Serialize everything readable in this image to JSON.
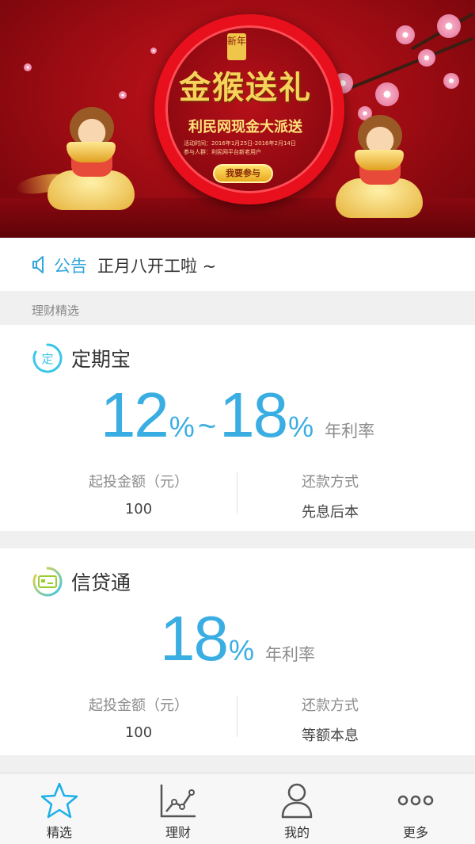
{
  "banner": {
    "seal_text": "新年",
    "main_title": "金猴送礼",
    "sub_title": "利民网现金大派送",
    "info_line1": "活动时间：2016年1月25日-2016年2月14日",
    "info_line2": "参与人群：利民网平台新老用户",
    "join_button": "我要参与"
  },
  "notice": {
    "icon": "speaker-icon",
    "label": "公告",
    "text": "正月八开工啦 ~"
  },
  "section": {
    "label": "理财精选"
  },
  "products": [
    {
      "name": "定期宝",
      "icon": "fixed-term-icon",
      "icon_text": "定",
      "rate_min": "12",
      "rate_max": "18",
      "percent": "%",
      "tilde": "~",
      "rate_unit": "年利率",
      "min_invest_label": "起投金额（元）",
      "min_invest_value": "100",
      "repay_label": "还款方式",
      "repay_value": "先息后本"
    },
    {
      "name": "信贷通",
      "icon": "credit-card-icon",
      "rate": "18",
      "percent": "%",
      "rate_unit": "年利率",
      "min_invest_label": "起投金额（元）",
      "min_invest_value": "100",
      "repay_label": "还款方式",
      "repay_value": "等额本息"
    }
  ],
  "tabs": [
    {
      "label": "精选",
      "icon": "star-icon",
      "active": true
    },
    {
      "label": "理财",
      "icon": "line-chart-icon",
      "active": false
    },
    {
      "label": "我的",
      "icon": "user-icon",
      "active": false
    },
    {
      "label": "更多",
      "icon": "more-dots-icon",
      "active": false
    }
  ],
  "colors": {
    "accent": "#3aaee2",
    "banner_red": "#c8141c",
    "gold": "#f6d25a"
  }
}
